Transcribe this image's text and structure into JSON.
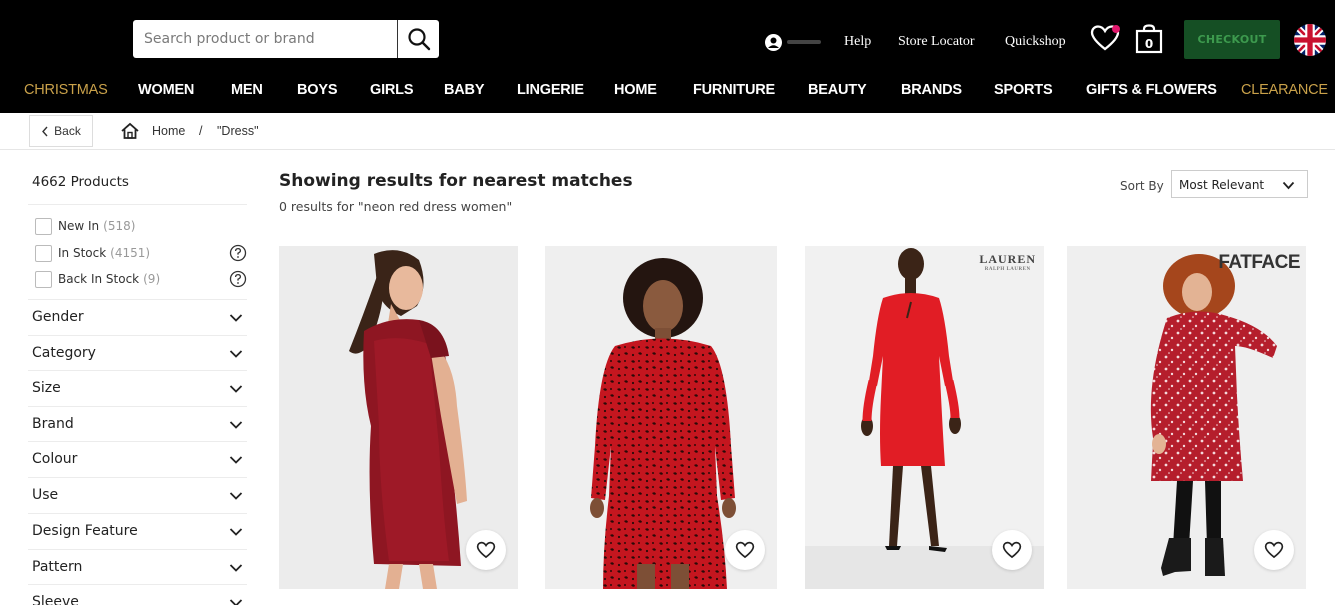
{
  "search": {
    "placeholder": "Search product or brand",
    "value": ""
  },
  "header": {
    "help": "Help",
    "store_locator": "Store Locator",
    "quickshop": "Quickshop",
    "bag_count": "0",
    "checkout": "CHECKOUT",
    "colors": {
      "bar": "#000000",
      "gold": "#c9a14a",
      "checkout_bg": "#154f24",
      "wishlist_dot": "#e0186c"
    }
  },
  "nav": {
    "items": [
      {
        "label": "CHRISTMAS",
        "highlight": true
      },
      {
        "label": "WOMEN"
      },
      {
        "label": "MEN"
      },
      {
        "label": "BOYS"
      },
      {
        "label": "GIRLS"
      },
      {
        "label": "BABY"
      },
      {
        "label": "LINGERIE"
      },
      {
        "label": "HOME"
      },
      {
        "label": "FURNITURE"
      },
      {
        "label": "BEAUTY"
      },
      {
        "label": "BRANDS"
      },
      {
        "label": "SPORTS"
      },
      {
        "label": "GIFTS & FLOWERS"
      },
      {
        "label": "CLEARANCE",
        "highlight": true
      }
    ]
  },
  "breadcrumb": {
    "back": "Back",
    "home": "Home",
    "separator": "/",
    "current": "\"Dress\""
  },
  "sidebar": {
    "count": "4662 Products",
    "checkboxes": [
      {
        "label": "New In",
        "count": "(518)",
        "checked": false
      },
      {
        "label": "In Stock",
        "count": "(4151)",
        "checked": false,
        "help_icon": "question-circle-icon"
      },
      {
        "label": "Back In Stock",
        "count": "(9)",
        "checked": false,
        "help_icon": "question-circle-icon"
      }
    ],
    "facets": [
      {
        "label": "Gender"
      },
      {
        "label": "Category"
      },
      {
        "label": "Size"
      },
      {
        "label": "Brand"
      },
      {
        "label": "Colour"
      },
      {
        "label": "Use"
      },
      {
        "label": "Design Feature"
      },
      {
        "label": "Pattern"
      },
      {
        "label": "Sleeve"
      }
    ]
  },
  "results": {
    "title": "Showing results for nearest matches",
    "subtitle": "0 results for \"neon red dress women\"",
    "sort_label": "Sort By",
    "sort_value": "Most Relevant"
  },
  "products": [
    {
      "image": "red sequin t-shirt dress",
      "brand_mark": ""
    },
    {
      "image": "red leopard print long sleeve dress",
      "brand_mark": ""
    },
    {
      "image": "red fitted sheath dress",
      "brand_mark": "LAUREN",
      "brand_sub": "RALPH LAUREN"
    },
    {
      "image": "red floral wrap dress",
      "brand_mark": "FATFACE"
    }
  ]
}
